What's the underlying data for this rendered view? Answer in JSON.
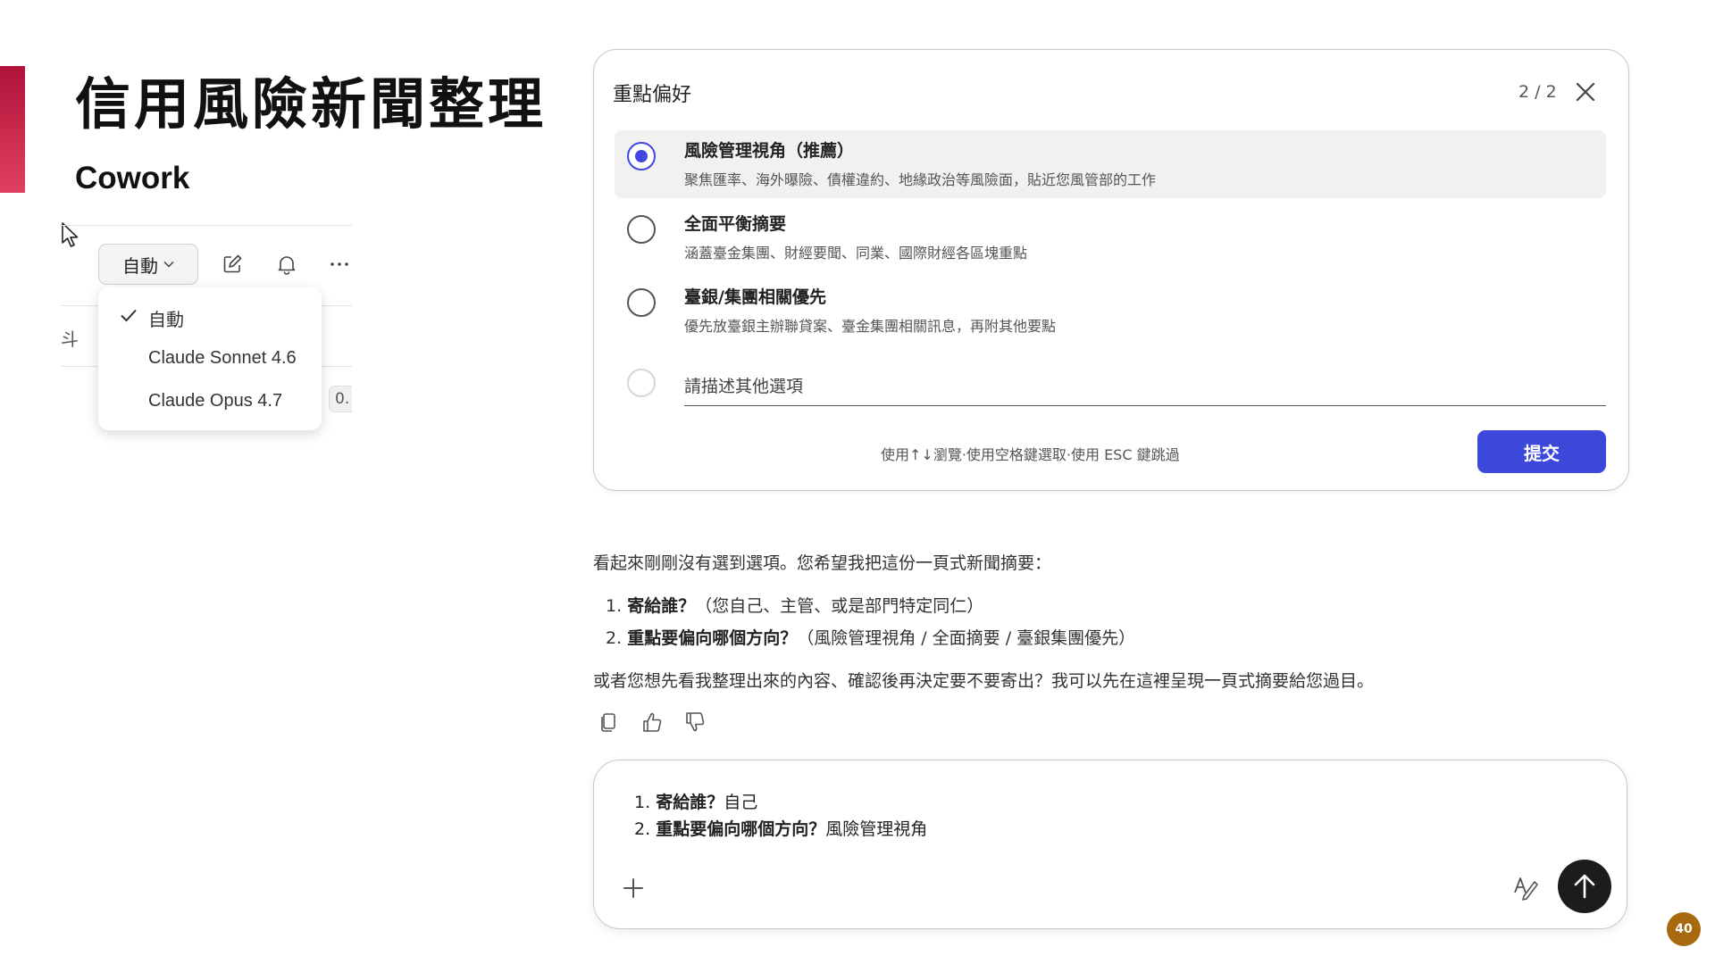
{
  "slide": {
    "title": "信用風險新聞整理",
    "subtitle": "Cowork",
    "page_number": "40",
    "accent_color": "#c8173f"
  },
  "toolbar": {
    "model_button_label": "自動",
    "icons": [
      "edit-icon",
      "bell-icon",
      "more-icon"
    ],
    "edge_char": "斗",
    "edge_badge": "0."
  },
  "model_menu": {
    "items": [
      {
        "label": "自動",
        "checked": true
      },
      {
        "label": "Claude Sonnet 4.6",
        "checked": false
      },
      {
        "label": "Claude Opus 4.7",
        "checked": false
      }
    ]
  },
  "question_card": {
    "title": "重點偏好",
    "counter": "2 / 2",
    "options": [
      {
        "title": "風險管理視角（推薦）",
        "desc": "聚焦匯率、海外曝險、債權違約、地緣政治等風險面，貼近您風管部的工作",
        "selected": true
      },
      {
        "title": "全面平衡摘要",
        "desc": "涵蓋臺金集團、財經要聞、同業、國際財經各區塊重點",
        "selected": false
      },
      {
        "title": "臺銀/集團相關優先",
        "desc": "優先放臺銀主辦聯貸案、臺金集團相關訊息，再附其他要點",
        "selected": false
      }
    ],
    "other_placeholder": "請描述其他選項",
    "hint": "使用↑↓瀏覽·使用空格鍵選取·使用 ESC 鍵跳過",
    "submit_label": "提交",
    "accent_color": "#3b48d9"
  },
  "assistant_message": {
    "intro": "看起來剛剛沒有選到選項。您希望我把這份一頁式新聞摘要：",
    "items": [
      {
        "number": "1.",
        "question": "寄給誰？",
        "detail": "（您自己、主管、或是部門特定同仁）"
      },
      {
        "number": "2.",
        "question": "重點要偏向哪個方向？",
        "detail": "（風險管理視角 / 全面摘要 / 臺銀集團優先）"
      }
    ],
    "followup": "或者您想先看我整理出來的內容、確認後再決定要不要寄出？我可以先在這裡呈現一頁式摘要給您過目。",
    "actions": [
      "copy-icon",
      "thumbs-up-icon",
      "thumbs-down-icon"
    ]
  },
  "composer": {
    "lines": [
      {
        "number": "1.",
        "question": "寄給誰？",
        "answer": "自己"
      },
      {
        "number": "2.",
        "question": "重點要偏向哪個方向？",
        "answer": "風險管理視角"
      }
    ]
  }
}
